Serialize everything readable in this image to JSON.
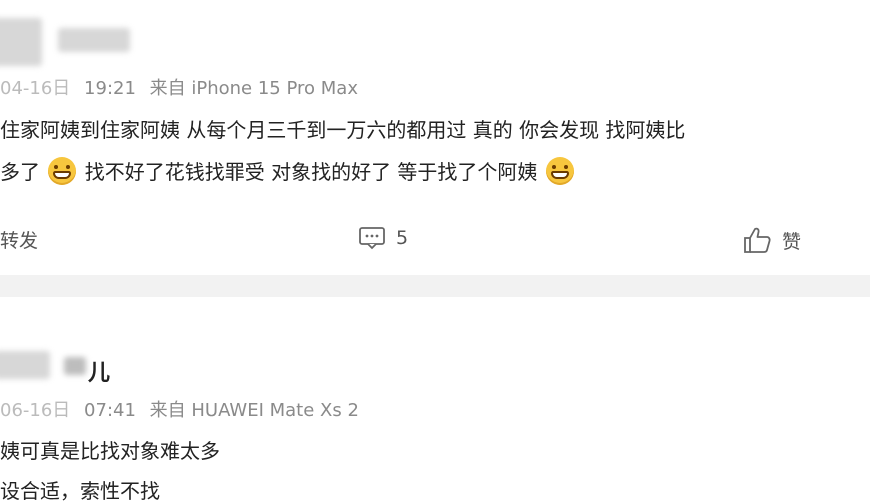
{
  "comments": [
    {
      "date": "04-16日",
      "time": "19:21",
      "source": "来自 iPhone 15 Pro Max",
      "lines": [
        "住家阿姨到住家阿姨 从每个月三千到一万六的都用过 真的 你会发现 找阿姨比",
        "多了",
        "找不好了花钱找罪受 对象找的好了 等于找了个阿姨"
      ],
      "emoji": "grin-emoji",
      "actions": {
        "repost": "转发",
        "comment_count": "5",
        "like": "赞"
      }
    },
    {
      "username_suffix": "儿",
      "date": "06-16日",
      "time": "07:41",
      "source": "来自 HUAWEI Mate Xs 2",
      "lines": [
        "姨可真是比找对象难太多",
        "设合适，索性不找"
      ]
    }
  ],
  "colors": {
    "text": "#222222",
    "meta": "#8a8a8a",
    "separator": "#f2f2f2",
    "emoji": "#f7c63e"
  }
}
